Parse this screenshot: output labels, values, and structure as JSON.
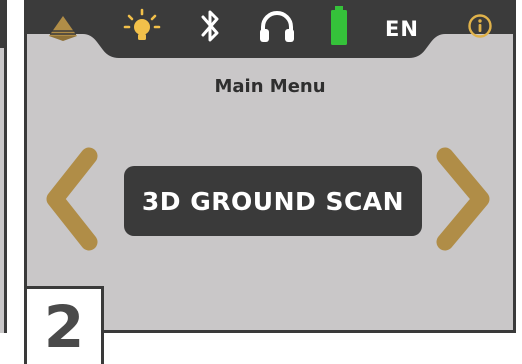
{
  "status_bar": {
    "icons": [
      {
        "name": "pyramid-logo-icon",
        "glyph": "pyramid"
      },
      {
        "name": "bulb-icon",
        "glyph": "bulb"
      },
      {
        "name": "bluetooth-icon",
        "glyph": "bluetooth"
      },
      {
        "name": "headphones-icon",
        "glyph": "headphones"
      },
      {
        "name": "battery-icon",
        "glyph": "battery",
        "level": 1.0
      },
      {
        "name": "info-icon",
        "glyph": "info"
      }
    ],
    "language": "EN"
  },
  "menu": {
    "title": "Main Menu",
    "current_mode": "3D GROUND SCAN"
  },
  "step_number": "2",
  "colors": {
    "screen_bg": "#c9c7c8",
    "bar_bg": "#3b3b3b",
    "accent_gold": "#b08d47",
    "battery_green": "#35c23a",
    "mode_box": "#3a3a3a",
    "text_dark": "#2f2f2f"
  }
}
